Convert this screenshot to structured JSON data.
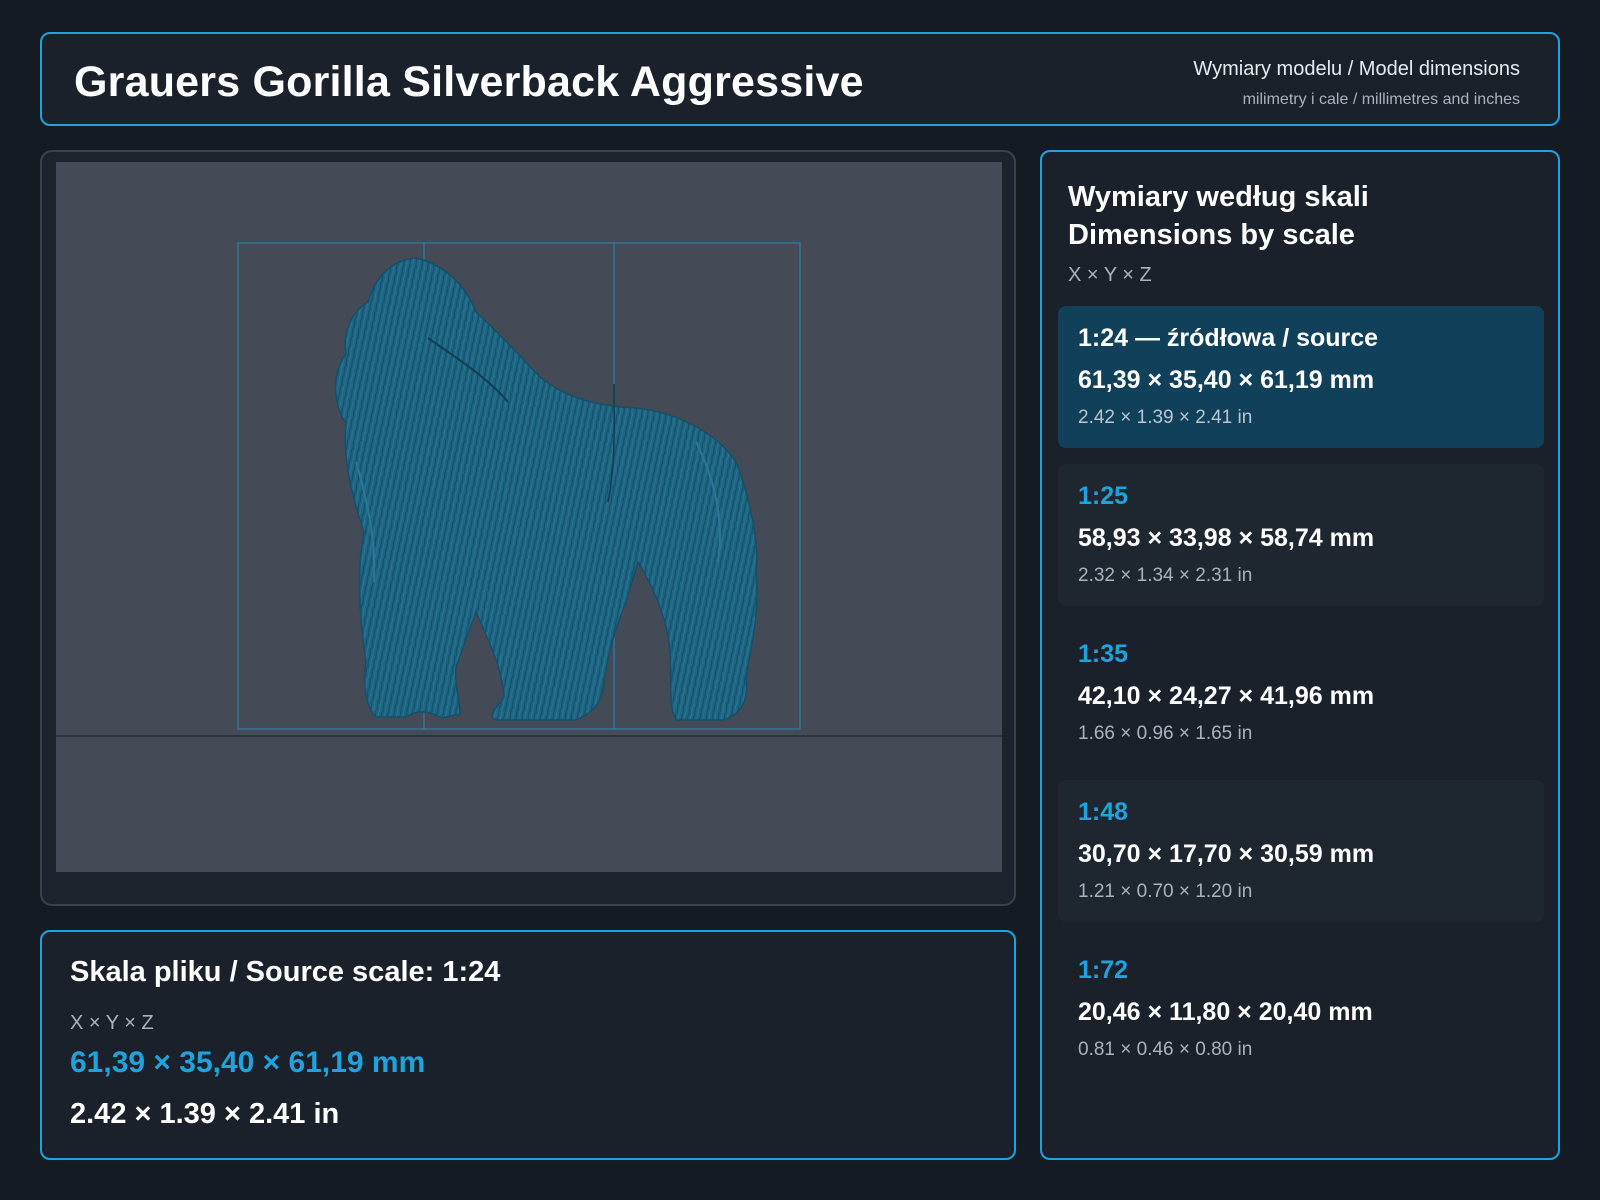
{
  "header": {
    "title": "Grauers Gorilla Silverback Aggressive",
    "subtitle": "Wymiary modelu / Model dimensions",
    "units_note": "milimetry i cale / millimetres and inches"
  },
  "viewer": {
    "model_color": "#1e6683",
    "bbox_color": "#1fa3dc",
    "background_color": "#444b56"
  },
  "source_info": {
    "title": "Skala pliku / Source scale: 1:24",
    "axes": "X × Y × Z",
    "mm": "61,39 × 35,40 × 61,19 mm",
    "inches": "2.42 × 1.39 × 2.41 in"
  },
  "scales_panel": {
    "title_pl": "Wymiary według skali",
    "title_en": "Dimensions by scale",
    "axes": "X × Y × Z",
    "items": [
      {
        "ratio": "1:24  —  źródłowa / source",
        "mm": "61,39 × 35,40 × 61,19 mm",
        "inches": "2.42 × 1.39 × 2.41 in",
        "active": true
      },
      {
        "ratio": "1:25",
        "mm": "58,93 × 33,98 × 58,74 mm",
        "inches": "2.32 × 1.34 × 2.31 in",
        "active": false
      },
      {
        "ratio": "1:35",
        "mm": "42,10 × 24,27 × 41,96 mm",
        "inches": "1.66 × 0.96 × 1.65 in",
        "active": false
      },
      {
        "ratio": "1:48",
        "mm": "30,70 × 17,70 × 30,59 mm",
        "inches": "1.21 × 0.70 × 1.20 in",
        "active": false
      },
      {
        "ratio": "1:72",
        "mm": "20,46 × 11,80 × 20,40 mm",
        "inches": "0.81 × 0.46 × 0.80 in",
        "active": false
      }
    ]
  },
  "colors": {
    "accent": "#1fa3dc",
    "active_card": "#10405a"
  }
}
